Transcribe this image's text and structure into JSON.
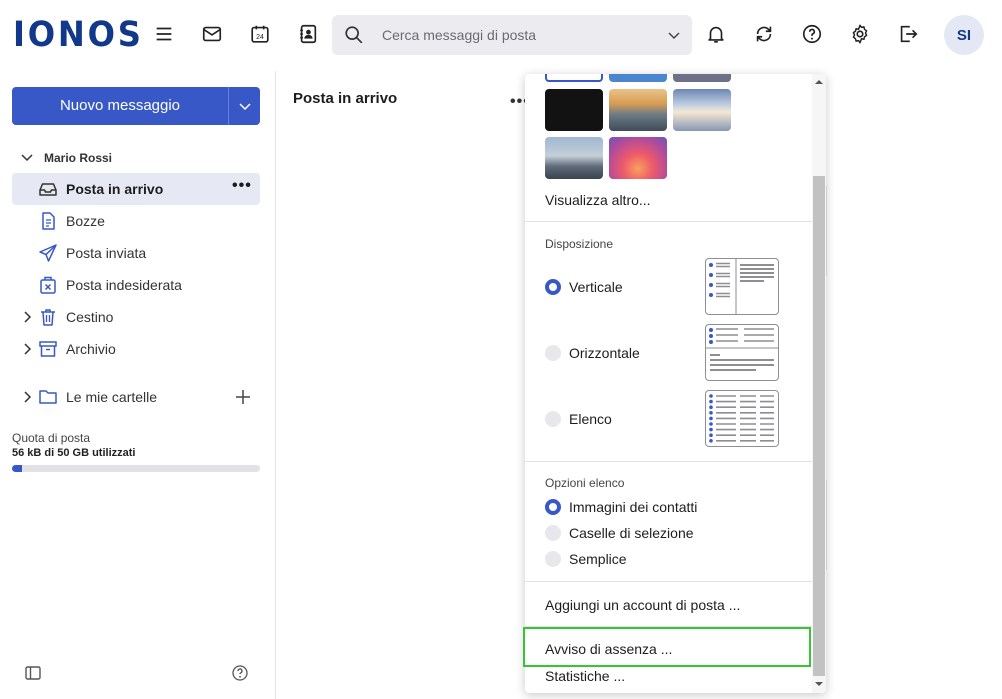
{
  "brand": {
    "logo_text": "IONOS",
    "accent": "#3858c7",
    "logo_color": "#11388a"
  },
  "header": {
    "icons": [
      "menu-icon",
      "mail-icon",
      "calendar-icon",
      "contacts-icon",
      "bell-icon",
      "sync-icon",
      "help-icon",
      "settings-icon",
      "logout-icon"
    ],
    "calendar_day": "24",
    "search_placeholder": "Cerca messaggi di posta",
    "avatar_initials": "SI"
  },
  "sidebar": {
    "new_message": "Nuovo messaggio",
    "account_name": "Mario Rossi",
    "folders": [
      {
        "label": "Posta in arrivo",
        "icon": "inbox-icon",
        "active": true
      },
      {
        "label": "Bozze",
        "icon": "draft-icon"
      },
      {
        "label": "Posta inviata",
        "icon": "sent-icon"
      },
      {
        "label": "Posta indesiderata",
        "icon": "spam-icon"
      },
      {
        "label": "Cestino",
        "icon": "trash-icon",
        "expandable": true
      },
      {
        "label": "Archivio",
        "icon": "archive-icon",
        "expandable": true
      }
    ],
    "my_folders": "Le mie cartelle",
    "more_dots": "•••",
    "quota": {
      "label": "Quota di posta",
      "value": "56 kB di 50 GB utilizzati",
      "fraction": 0.04
    }
  },
  "main": {
    "title": "Posta in arrivo",
    "more_dots": "•••"
  },
  "settings_panel": {
    "show_more": "Visualizza altro...",
    "layout": {
      "title": "Disposizione",
      "options": [
        {
          "label": "Verticale",
          "selected": true
        },
        {
          "label": "Orizzontale",
          "selected": false
        },
        {
          "label": "Elenco",
          "selected": false
        }
      ]
    },
    "list_options": {
      "title": "Opzioni elenco",
      "options": [
        {
          "label": "Immagini dei contatti",
          "selected": true
        },
        {
          "label": "Caselle di selezione",
          "selected": false
        },
        {
          "label": "Semplice",
          "selected": false
        }
      ]
    },
    "add_account": "Aggiungi un account di posta ...",
    "out_of_office": "Avviso di assenza ...",
    "statistics": "Statistiche ..."
  }
}
